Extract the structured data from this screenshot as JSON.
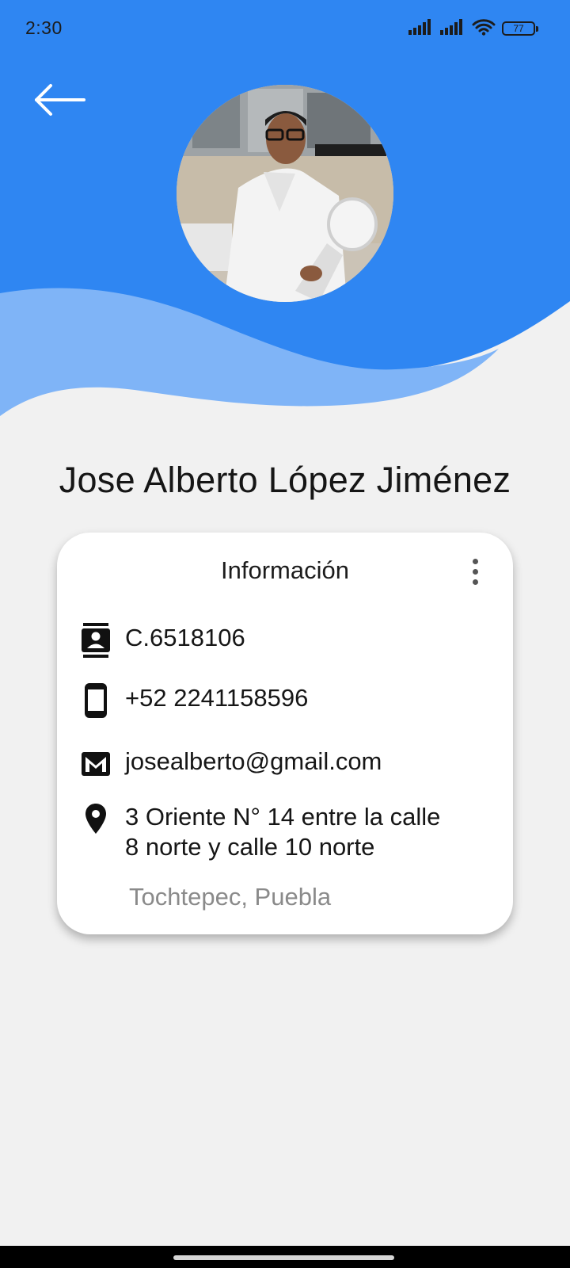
{
  "status_bar": {
    "time": "2:30",
    "battery": "77",
    "icons": [
      "signal-icon",
      "signal-icon",
      "wifi-icon",
      "battery-icon"
    ]
  },
  "colors": {
    "header_blue": "#2f86f2",
    "wave_light_blue": "#7fb4f7",
    "background": "#f1f1f1",
    "card": "#ffffff",
    "secondary_text": "#8a8a8a"
  },
  "profile": {
    "name": "Jose Alberto López Jiménez"
  },
  "card": {
    "title": "Información",
    "license": "C.6518106",
    "phone": "+52 2241158596",
    "email": "josealberto@gmail.com",
    "address_line1": "3 Oriente N° 14 entre la calle",
    "address_line2": "8 norte y calle 10 norte",
    "city": "Tochtepec, Puebla"
  },
  "icons": {
    "back": "arrow-back-icon",
    "license": "contact-card-icon",
    "phone": "smartphone-icon",
    "email": "mail-icon",
    "address": "location-pin-icon",
    "more": "more-vert-icon"
  }
}
